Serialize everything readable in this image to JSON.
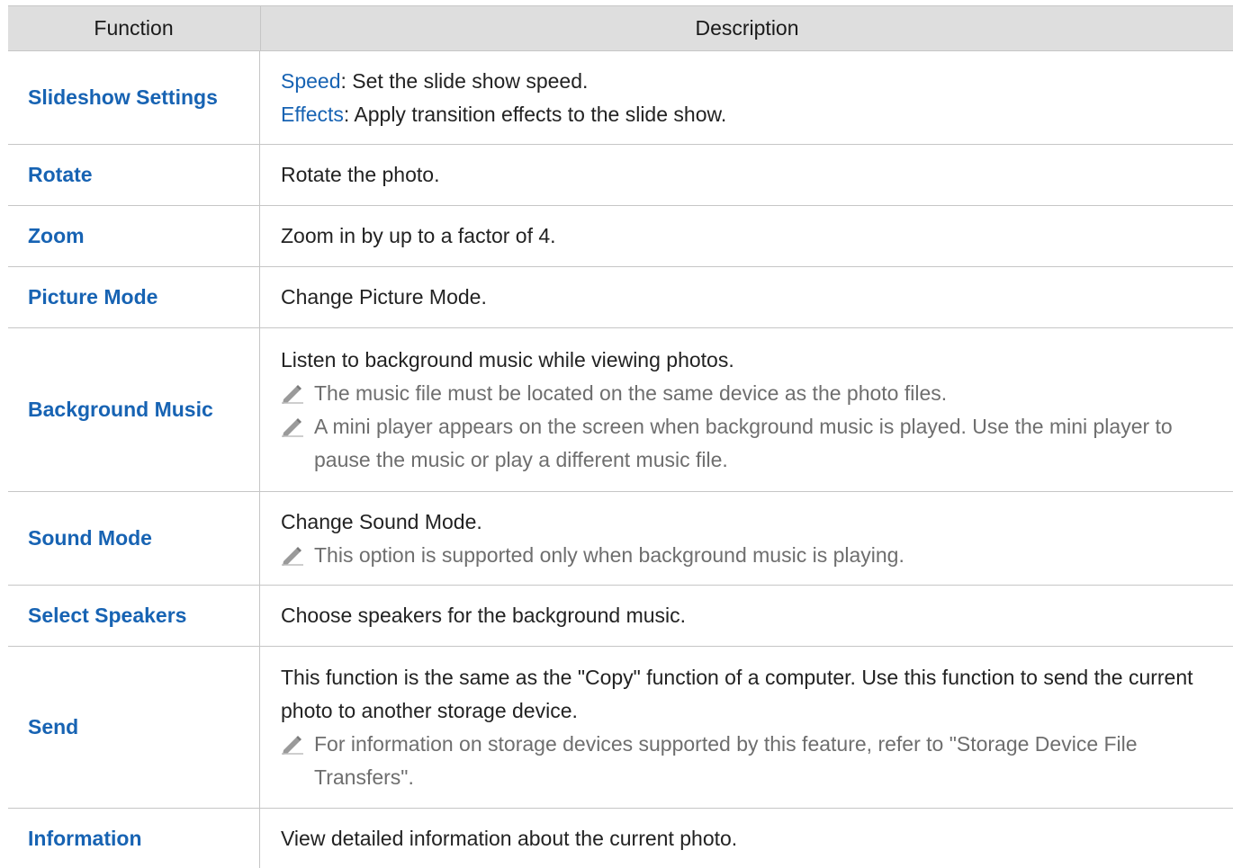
{
  "header": {
    "col_function": "Function",
    "col_description": "Description"
  },
  "rows": [
    {
      "function": "Slideshow Settings",
      "lines": [
        {
          "label": "Speed",
          "text": ": Set the slide show speed."
        },
        {
          "label": "Effects",
          "text": ": Apply transition effects to the slide show."
        }
      ]
    },
    {
      "function": "Rotate",
      "text": "Rotate the photo."
    },
    {
      "function": "Zoom",
      "text": "Zoom in by up to a factor of 4."
    },
    {
      "function": "Picture Mode",
      "text": "Change Picture Mode."
    },
    {
      "function": "Background Music",
      "text": "Listen to background music while viewing photos.",
      "notes": [
        "The music file must be located on the same device as the photo files.",
        "A mini player appears on the screen when background music is played. Use the mini player to pause the music or play a different music file."
      ]
    },
    {
      "function": "Sound Mode",
      "text": "Change Sound Mode.",
      "notes": [
        "This option is supported only when background music is playing."
      ]
    },
    {
      "function": "Select Speakers",
      "text": "Choose speakers for the background music."
    },
    {
      "function": "Send",
      "text": "This function is the same as the \"Copy\" function of a computer. Use this function to send the current photo to another storage device.",
      "notes": [
        "For information on storage devices supported by this feature, refer to \"Storage Device File Transfers\"."
      ]
    },
    {
      "function": "Information",
      "text": "View detailed information about the current photo."
    }
  ],
  "icons": {
    "note": "pencil-icon"
  },
  "colors": {
    "accent": "#1763b3",
    "note_text": "#6e6e6e",
    "header_bg": "#dedede",
    "border": "#c6c6c6"
  }
}
